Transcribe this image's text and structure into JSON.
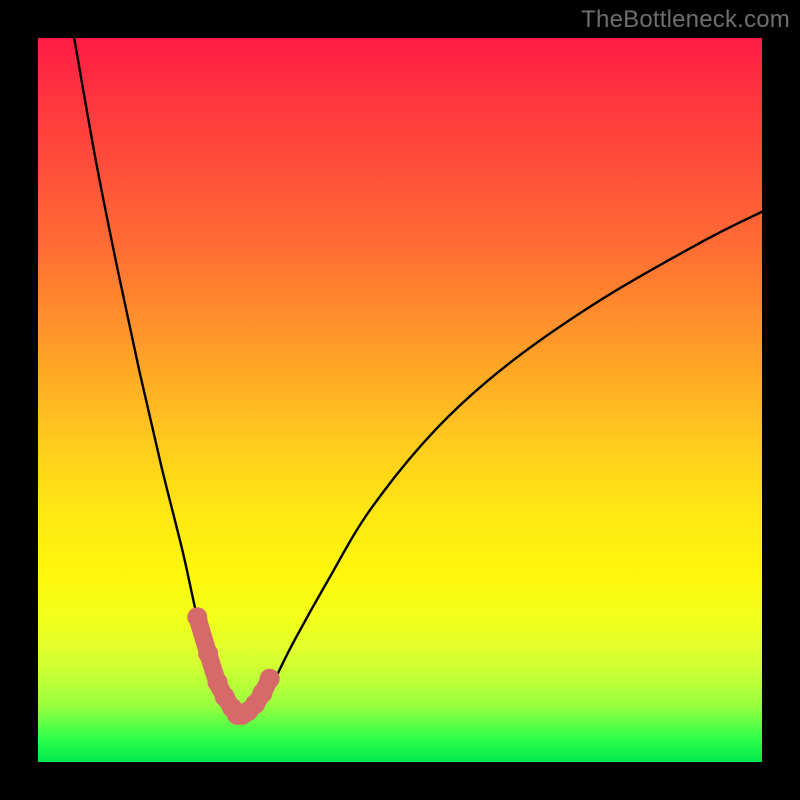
{
  "watermark": {
    "text": "TheBottleneck.com"
  },
  "chart_data": {
    "type": "line",
    "title": "",
    "xlabel": "",
    "ylabel": "",
    "xlim": [
      0,
      100
    ],
    "ylim": [
      0,
      100
    ],
    "grid": false,
    "legend": false,
    "series": [
      {
        "name": "bottleneck-curve",
        "color": "#000000",
        "x": [
          5,
          8,
          11,
          14,
          17,
          20,
          22,
          24,
          25.5,
          27,
          28.5,
          30,
          32,
          35,
          40,
          46,
          55,
          65,
          78,
          92,
          100
        ],
        "y": [
          100,
          83,
          68,
          54,
          41,
          29,
          20,
          13,
          9,
          6.5,
          6,
          7,
          10,
          16,
          25,
          35,
          46,
          55,
          64,
          72,
          76
        ]
      },
      {
        "name": "highlight-bottom",
        "color": "#d66a6a",
        "x": [
          22,
          23.5,
          24.8,
          25.8,
          26.8,
          27.5,
          28.2,
          29,
          30,
          31,
          32
        ],
        "y": [
          20,
          15,
          11,
          9,
          7.5,
          6.5,
          6.5,
          7,
          8,
          9.5,
          11.5
        ]
      }
    ]
  }
}
